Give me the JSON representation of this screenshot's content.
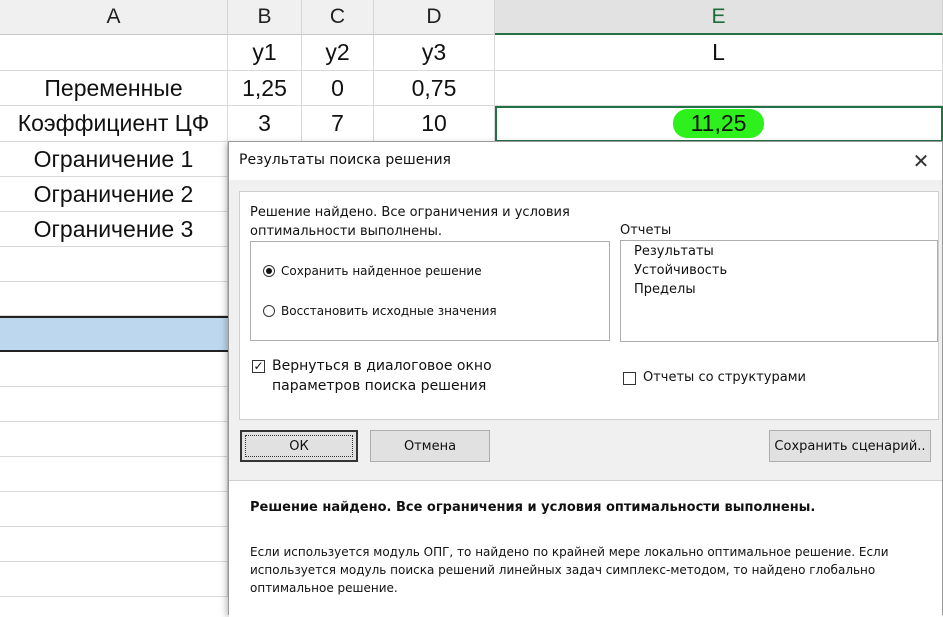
{
  "sheet": {
    "columns": [
      "A",
      "B",
      "C",
      "D",
      "E"
    ],
    "header_row": {
      "b": "y1",
      "c": "y2",
      "d": "y3",
      "e": "L"
    },
    "rows": [
      {
        "label": "Переменные",
        "b": "1,25",
        "c": "0",
        "d": "0,75",
        "e": ""
      },
      {
        "label": "Коэффициент ЦФ",
        "b": "3",
        "c": "7",
        "d": "10",
        "e": "11,25"
      },
      {
        "label": "Ограничение 1"
      },
      {
        "label": "Ограничение 2"
      },
      {
        "label": "Ограничение 3"
      }
    ],
    "highlight_color": "#2ef01c",
    "selected_row_color": "#bdd7ee"
  },
  "dialog": {
    "title": "Результаты поиска решения",
    "close_icon": "close-icon",
    "message": "Решение найдено. Все ограничения и условия оптимальности выполнены.",
    "radio_keep": "Сохранить найденное решение",
    "radio_restore": "Восстановить исходные значения",
    "radio_selected": "keep",
    "reports_label": "Отчеты",
    "reports": [
      "Результаты",
      "Устойчивость",
      "Пределы"
    ],
    "return_checkbox": "Вернуться в диалоговое окно параметров поиска решения",
    "return_checked": true,
    "outline_checkbox": "Отчеты со структурами",
    "outline_checked": false,
    "ok_button": "ОК",
    "cancel_button": "Отмена",
    "save_scenario_button": "Сохранить сценарий..",
    "info_head": "Решение найдено. Все ограничения и условия оптимальности выполнены.",
    "info_body": "Если используется модуль ОПГ, то найдено по крайней мере локально оптимальное решение. Если используется модуль поиска решений линейных задач симплекс-методом, то найдено глобально оптимальное решение."
  }
}
